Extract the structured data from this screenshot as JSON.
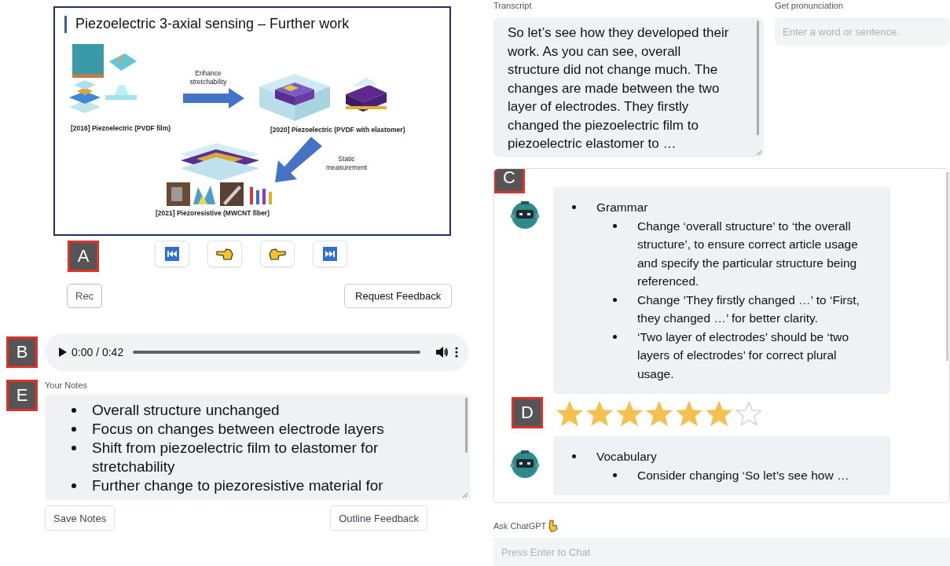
{
  "slide": {
    "title": "Piezoelectric 3-axial sensing – Further work",
    "labels": [
      {
        "kind": "caption",
        "text": "[2016] Piezoelectric (PVDF film)"
      },
      {
        "kind": "arrow_label",
        "text": "Enhance stretchability"
      },
      {
        "kind": "caption",
        "text": "[2020] Piezoelectric (PVDF with elastomer)"
      },
      {
        "kind": "arrow_label",
        "text": "Static measurement"
      },
      {
        "kind": "caption",
        "text": "[2021] Piezoresistive (MWCNT fiber)"
      }
    ]
  },
  "slide_controls": {
    "marker": "A",
    "buttons": [
      {
        "kind": "first"
      },
      {
        "kind": "previous"
      },
      {
        "kind": "next"
      },
      {
        "kind": "last"
      }
    ]
  },
  "record_button": "Rec",
  "request_feedback_button": "Request Feedback",
  "audio_player": {
    "marker": "B",
    "time": "0:00 / 0:42"
  },
  "notes": {
    "marker": "E",
    "label": "Your Notes",
    "items": [
      "Overall structure unchanged",
      "Focus on changes between electrode layers",
      "Shift from piezoelectric film to elastomer for stretchability",
      "Further change to piezoresistive material for"
    ]
  },
  "save_notes_button": "Save Notes",
  "outline_feedback_button": "Outline Feedback",
  "transcript": {
    "label": "Transcript",
    "text": "So let’s see how they developed their work. As you can see, overall structure did not change much. The changes are made between the two layer of electrodes. They firstly changed the piezoelectric film to piezoelectric elastomer to …"
  },
  "pronunciation": {
    "label": "Get pronunciation",
    "placeholder": "Enter a word or sentence."
  },
  "feedback": {
    "marker": "C",
    "rating_marker": "D",
    "messages": [
      {
        "category": "Grammar",
        "items": [
          "Change ‘overall structure’ to ‘the overall structure’, to ensure correct article usage and specify the particular structure being referenced.",
          "Change ’They firstly changed …’ to ‘First, they changed …’ for better clarity.",
          "‘Two layer of electrodes’ should be ‘two layers of electrodes’ for correct plural usage."
        ],
        "stars": 6
      },
      {
        "category": "Vocabulary",
        "items": [
          "Consider changing ‘So let’s see how …"
        ]
      }
    ]
  },
  "chat": {
    "label": "Ask ChatGPT",
    "placeholder": "Press Enter to Chat"
  }
}
